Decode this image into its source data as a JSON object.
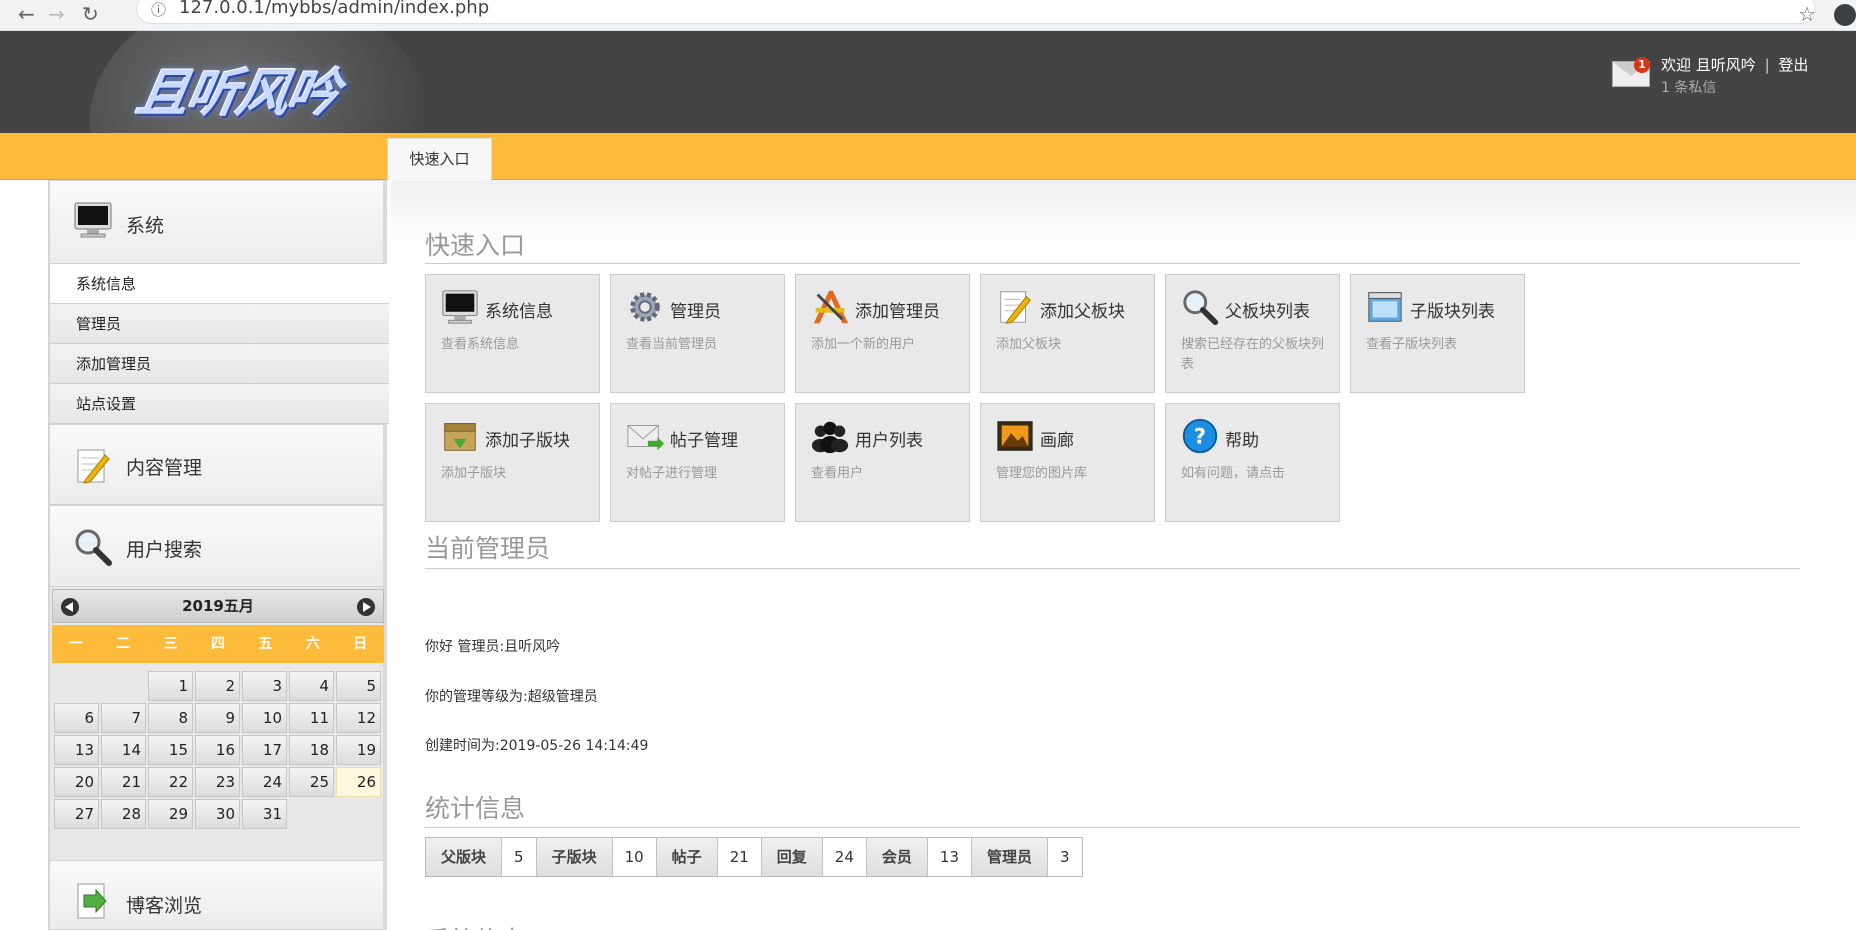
{
  "browser": {
    "url": "127.0.0.1/mybbs/admin/index.php",
    "back_icon": "←",
    "forward_icon": "→",
    "reload_icon": "↻",
    "info_icon": "ⓘ",
    "star_icon": "☆"
  },
  "header": {
    "logo_text": "且听风吟",
    "mail_badge": "1",
    "welcome": "欢迎 且听风吟",
    "separator": "|",
    "logout": "登出",
    "pm_text": "1 条私信"
  },
  "tabs": {
    "quick": "快速入口"
  },
  "sidebar": {
    "system": "系统",
    "items": [
      "系统信息",
      "管理员",
      "添加管理员",
      "站点设置"
    ],
    "content": "内容管理",
    "user_search": "用户搜索",
    "blog": "博客浏览"
  },
  "calendar": {
    "title": "2019五月",
    "weekdays": [
      "一",
      "二",
      "三",
      "四",
      "五",
      "六",
      "日"
    ],
    "leading_blanks": 2,
    "days": 31,
    "today": 26
  },
  "main": {
    "quick_title": "快速入口",
    "tiles": [
      {
        "title": "系统信息",
        "desc": "查看系统信息",
        "icon": "monitor-icon"
      },
      {
        "title": "管理员",
        "desc": "查看当前管理员",
        "icon": "gear-icon"
      },
      {
        "title": "添加管理员",
        "desc": "添加一个新的用户",
        "icon": "tools-icon"
      },
      {
        "title": "添加父板块",
        "desc": "添加父板块",
        "icon": "edit-icon"
      },
      {
        "title": "父板块列表",
        "desc": "搜索已经存在的父板块列表",
        "icon": "search-icon"
      },
      {
        "title": "子版块列表",
        "desc": "查看子版块列表",
        "icon": "window-icon"
      },
      {
        "title": "添加子版块",
        "desc": "添加子版块",
        "icon": "box-icon"
      },
      {
        "title": "帖子管理",
        "desc": "对帖子进行管理",
        "icon": "mail-icon"
      },
      {
        "title": "用户列表",
        "desc": "查看用户",
        "icon": "users-icon"
      },
      {
        "title": "画廊",
        "desc": "管理您的图片库",
        "icon": "gallery-icon"
      },
      {
        "title": "帮助",
        "desc": "如有问题，请点击",
        "icon": "help-icon"
      }
    ],
    "admin_title": "当前管理员",
    "admin_hello": "你好 管理员:且听风吟",
    "admin_level": "你的管理等级为:超级管理员",
    "admin_created": "创建时间为:2019-05-26 14:14:49",
    "stats_title": "统计信息",
    "stats": [
      {
        "k": "父版块",
        "v": "5"
      },
      {
        "k": "子版块",
        "v": "10"
      },
      {
        "k": "帖子",
        "v": "21"
      },
      {
        "k": "回复",
        "v": "24"
      },
      {
        "k": "会员",
        "v": "13"
      },
      {
        "k": "管理员",
        "v": "3"
      }
    ],
    "sysinfo_title": "系统信息"
  }
}
